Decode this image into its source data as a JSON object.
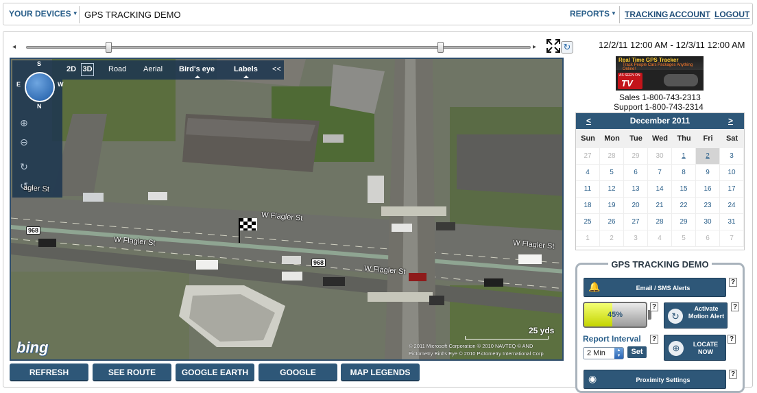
{
  "topbar": {
    "devices_label": "YOUR DEVICES",
    "app_title": "GPS TRACKING DEMO",
    "reports_label": "REPORTS",
    "links": [
      "TRACKING",
      "ACCOUNT",
      "LOGOUT"
    ]
  },
  "timeline": {
    "date_range": "12/2/11 12:00 AM - 12/3/11 12:00 AM",
    "left_arrow": "◂",
    "right_arrow": "▸",
    "refresh_glyph": "↻"
  },
  "map": {
    "toolbar": {
      "mode_2d": "2D",
      "mode_3d": "3D",
      "road": "Road",
      "aerial": "Aerial",
      "birds_eye": "Bird's eye",
      "labels": "Labels",
      "collapse": "<<"
    },
    "compass": {
      "n": "N",
      "s": "S",
      "e": "E",
      "w": "W"
    },
    "streets": [
      "W Flagler St",
      "W Flagler St",
      "W Flagler St",
      "W Flagler St",
      "W Flagler St",
      "agler St"
    ],
    "route_shields": [
      "968",
      "968"
    ],
    "scale_label": "25 yds",
    "copyright_line1": "© 2011 Microsoft Corporation   © 2010 NAVTEQ   © AND",
    "copyright_line2": "Pictometry Bird's Eye © 2010 Pictometry International Corp",
    "logo": "bing"
  },
  "bottom_buttons": [
    "REFRESH",
    "SEE ROUTE",
    "GOOGLE EARTH",
    "GOOGLE",
    "MAP LEGENDS"
  ],
  "ad": {
    "title": "Real Time GPS Tracker",
    "subtitle": "Track People Cars Packages Anything Online!",
    "seen_on": "AS SEEN ON",
    "tv": "TV"
  },
  "contact": {
    "sales": "Sales 1-800-743-2313",
    "support": "Support 1-800-743-2314"
  },
  "calendar": {
    "month_label": "December 2011",
    "prev": "<",
    "next": ">",
    "weekdays": [
      "Sun",
      "Mon",
      "Tue",
      "Wed",
      "Thu",
      "Fri",
      "Sat"
    ],
    "selected_day": "2",
    "weeks": [
      [
        "27",
        "28",
        "29",
        "30",
        "1",
        "2",
        "3"
      ],
      [
        "4",
        "5",
        "6",
        "7",
        "8",
        "9",
        "10"
      ],
      [
        "11",
        "12",
        "13",
        "14",
        "15",
        "16",
        "17"
      ],
      [
        "18",
        "19",
        "20",
        "21",
        "22",
        "23",
        "24"
      ],
      [
        "25",
        "26",
        "27",
        "28",
        "29",
        "30",
        "31"
      ],
      [
        "1",
        "2",
        "3",
        "4",
        "5",
        "6",
        "7"
      ]
    ]
  },
  "gps_panel": {
    "title": "GPS TRACKING DEMO",
    "email_alerts": "Email / SMS Alerts",
    "battery_percent": "45%",
    "battery_level": 0.45,
    "motion_alert": "Activate Motion Alert",
    "report_interval_label": "Report Interval",
    "report_interval_value": "2 Min",
    "set_label": "Set",
    "locate_now": "LOCATE NOW",
    "proximity": "Proximity Settings",
    "help": "?"
  },
  "colors": {
    "accent": "#2e5778",
    "link": "#2a5f8a",
    "battery": "#d6e41c"
  }
}
